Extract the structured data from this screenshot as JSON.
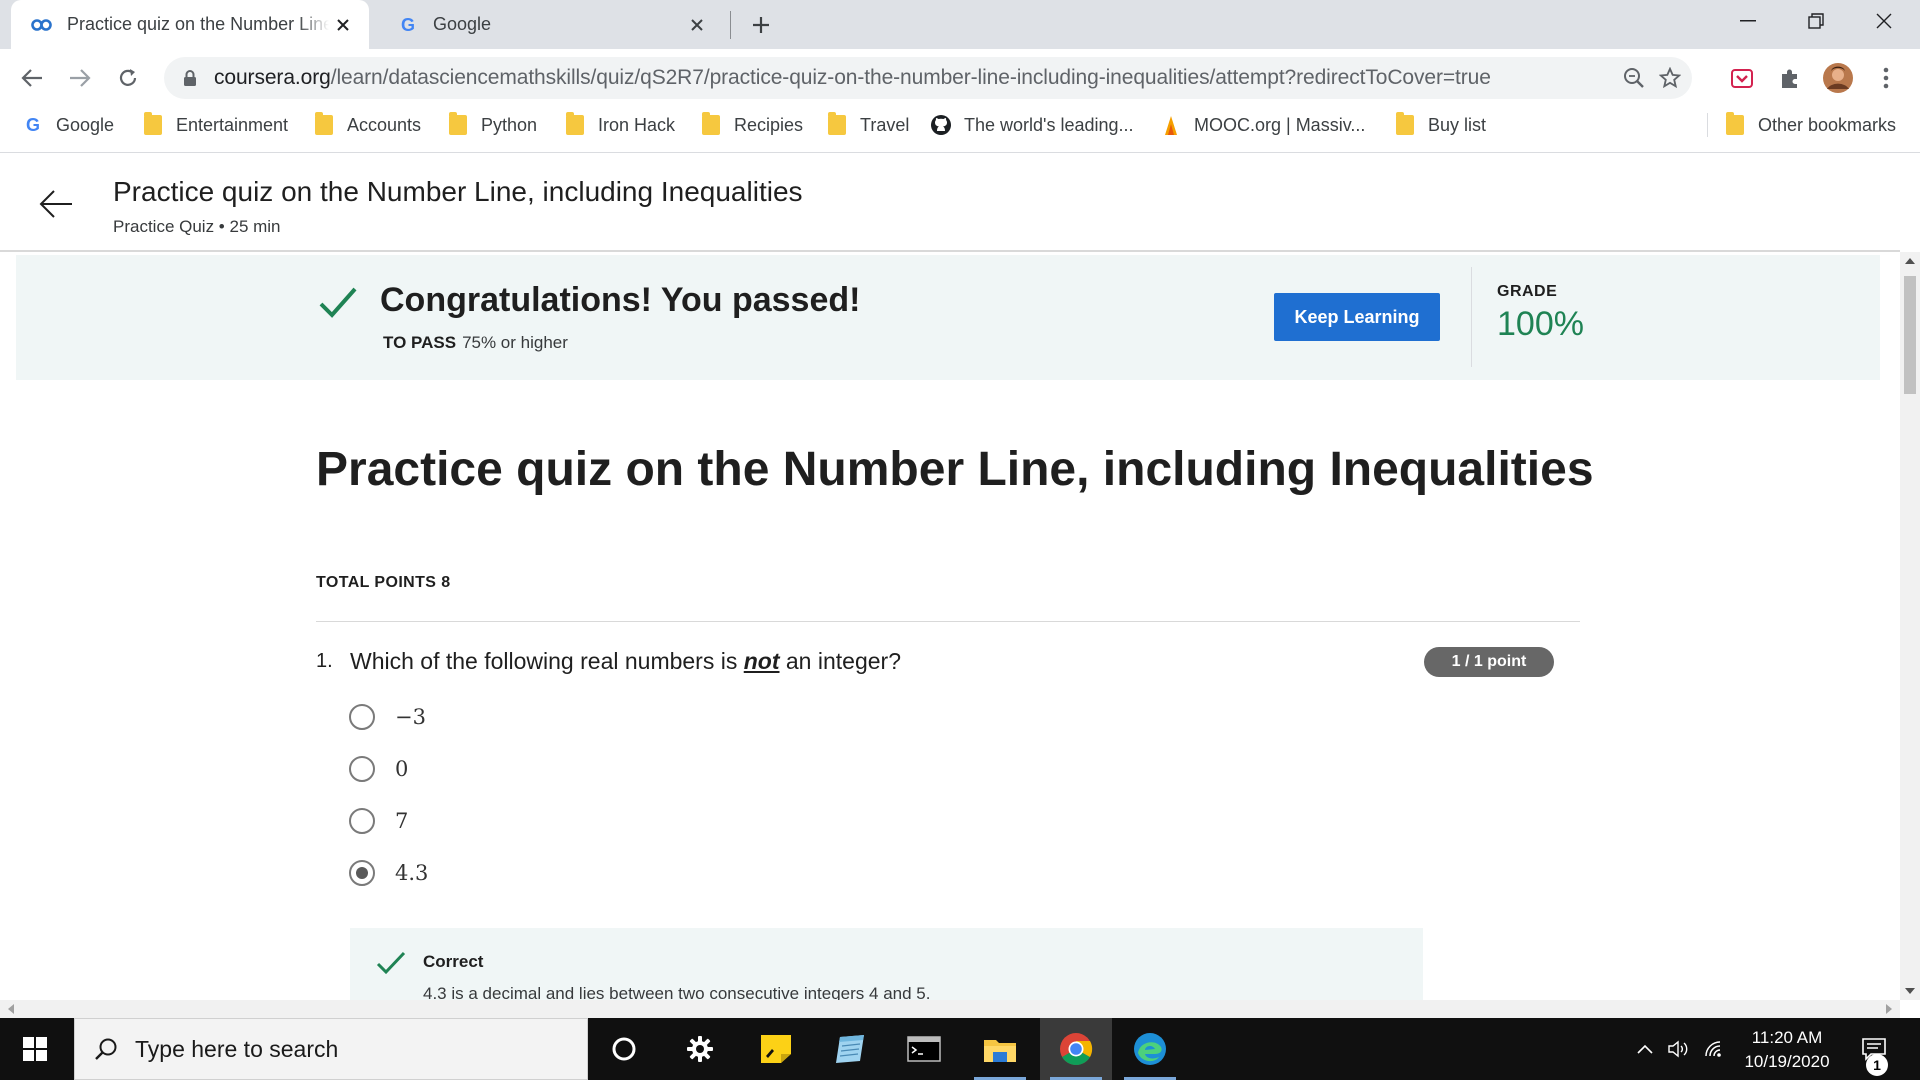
{
  "browser": {
    "tabs": [
      {
        "title": "Practice quiz on the Number Line, including Inequalities",
        "favicon": "coursera-icon",
        "active": true
      },
      {
        "title": "Google",
        "favicon": "google-icon",
        "active": false
      }
    ],
    "url_host": "coursera.org",
    "url_path": "/learn/datasciencemathskills/quiz/qS2R7/practice-quiz-on-the-number-line-including-inequalities/attempt?redirectToCover=true",
    "bookmarks": [
      {
        "label": "Google",
        "icon": "google-icon"
      },
      {
        "label": "Entertainment",
        "icon": "folder-icon"
      },
      {
        "label": "Accounts",
        "icon": "folder-icon"
      },
      {
        "label": "Python",
        "icon": "folder-icon"
      },
      {
        "label": "Iron Hack",
        "icon": "folder-icon"
      },
      {
        "label": "Recipies",
        "icon": "folder-icon"
      },
      {
        "label": "Travel",
        "icon": "folder-icon"
      },
      {
        "label": "The world's leading...",
        "icon": "github-icon"
      },
      {
        "label": "MOOC.org | Massiv...",
        "icon": "mooc-icon"
      },
      {
        "label": "Buy list",
        "icon": "folder-icon"
      }
    ],
    "other_bookmarks": "Other bookmarks"
  },
  "header": {
    "title": "Practice quiz on the Number Line, including Inequalities",
    "subtitle": "Practice Quiz • 25 min"
  },
  "banner": {
    "heading": "Congratulations! You passed!",
    "to_pass_label": "TO PASS",
    "to_pass_value": "75% or higher",
    "button": "Keep Learning",
    "grade_label": "GRADE",
    "grade_value": "100%"
  },
  "quiz": {
    "title": "Practice quiz on the Number Line, including Inequalities",
    "total_points": "TOTAL POINTS 8",
    "question": {
      "number": "1.",
      "text_before": "Which of the following real numbers is ",
      "text_emphasis": "not",
      "text_after": " an integer?",
      "points": "1 / 1 point",
      "options": [
        "−3",
        "0",
        "7",
        "4.3"
      ],
      "selected_index": 3,
      "feedback_label": "Correct",
      "feedback_text": "4.3 is a decimal and lies between two consecutive integers 4 and 5."
    }
  },
  "taskbar": {
    "search_placeholder": "Type here to search",
    "time": "11:20 AM",
    "date": "10/19/2020",
    "notifications": "1"
  },
  "colors": {
    "accent_button": "#1f6fd1",
    "success_green": "#1f8354",
    "banner_bg": "#f0f6f6"
  }
}
